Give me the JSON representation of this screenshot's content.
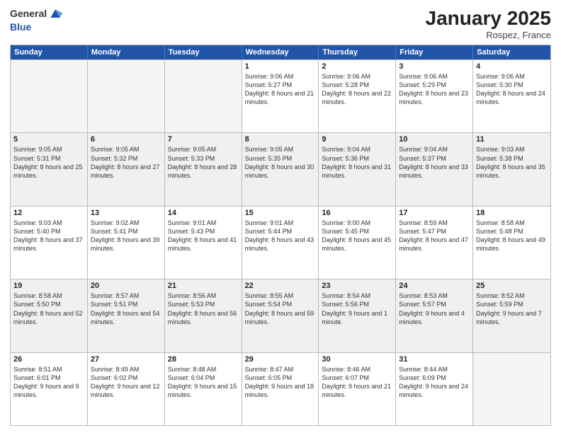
{
  "logo": {
    "general": "General",
    "blue": "Blue"
  },
  "title": "January 2025",
  "location": "Rospez, France",
  "days_of_week": [
    "Sunday",
    "Monday",
    "Tuesday",
    "Wednesday",
    "Thursday",
    "Friday",
    "Saturday"
  ],
  "weeks": [
    [
      {
        "day": "",
        "info": ""
      },
      {
        "day": "",
        "info": ""
      },
      {
        "day": "",
        "info": ""
      },
      {
        "day": "1",
        "info": "Sunrise: 9:06 AM\nSunset: 5:27 PM\nDaylight: 8 hours and 21 minutes."
      },
      {
        "day": "2",
        "info": "Sunrise: 9:06 AM\nSunset: 5:28 PM\nDaylight: 8 hours and 22 minutes."
      },
      {
        "day": "3",
        "info": "Sunrise: 9:06 AM\nSunset: 5:29 PM\nDaylight: 8 hours and 23 minutes."
      },
      {
        "day": "4",
        "info": "Sunrise: 9:06 AM\nSunset: 5:30 PM\nDaylight: 8 hours and 24 minutes."
      }
    ],
    [
      {
        "day": "5",
        "info": "Sunrise: 9:05 AM\nSunset: 5:31 PM\nDaylight: 8 hours and 25 minutes."
      },
      {
        "day": "6",
        "info": "Sunrise: 9:05 AM\nSunset: 5:32 PM\nDaylight: 8 hours and 27 minutes."
      },
      {
        "day": "7",
        "info": "Sunrise: 9:05 AM\nSunset: 5:33 PM\nDaylight: 8 hours and 28 minutes."
      },
      {
        "day": "8",
        "info": "Sunrise: 9:05 AM\nSunset: 5:35 PM\nDaylight: 8 hours and 30 minutes."
      },
      {
        "day": "9",
        "info": "Sunrise: 9:04 AM\nSunset: 5:36 PM\nDaylight: 8 hours and 31 minutes."
      },
      {
        "day": "10",
        "info": "Sunrise: 9:04 AM\nSunset: 5:37 PM\nDaylight: 8 hours and 33 minutes."
      },
      {
        "day": "11",
        "info": "Sunrise: 9:03 AM\nSunset: 5:38 PM\nDaylight: 8 hours and 35 minutes."
      }
    ],
    [
      {
        "day": "12",
        "info": "Sunrise: 9:03 AM\nSunset: 5:40 PM\nDaylight: 8 hours and 37 minutes."
      },
      {
        "day": "13",
        "info": "Sunrise: 9:02 AM\nSunset: 5:41 PM\nDaylight: 8 hours and 39 minutes."
      },
      {
        "day": "14",
        "info": "Sunrise: 9:01 AM\nSunset: 5:43 PM\nDaylight: 8 hours and 41 minutes."
      },
      {
        "day": "15",
        "info": "Sunrise: 9:01 AM\nSunset: 5:44 PM\nDaylight: 8 hours and 43 minutes."
      },
      {
        "day": "16",
        "info": "Sunrise: 9:00 AM\nSunset: 5:45 PM\nDaylight: 8 hours and 45 minutes."
      },
      {
        "day": "17",
        "info": "Sunrise: 8:59 AM\nSunset: 5:47 PM\nDaylight: 8 hours and 47 minutes."
      },
      {
        "day": "18",
        "info": "Sunrise: 8:58 AM\nSunset: 5:48 PM\nDaylight: 8 hours and 49 minutes."
      }
    ],
    [
      {
        "day": "19",
        "info": "Sunrise: 8:58 AM\nSunset: 5:50 PM\nDaylight: 8 hours and 52 minutes."
      },
      {
        "day": "20",
        "info": "Sunrise: 8:57 AM\nSunset: 5:51 PM\nDaylight: 8 hours and 54 minutes."
      },
      {
        "day": "21",
        "info": "Sunrise: 8:56 AM\nSunset: 5:53 PM\nDaylight: 8 hours and 56 minutes."
      },
      {
        "day": "22",
        "info": "Sunrise: 8:55 AM\nSunset: 5:54 PM\nDaylight: 8 hours and 59 minutes."
      },
      {
        "day": "23",
        "info": "Sunrise: 8:54 AM\nSunset: 5:56 PM\nDaylight: 9 hours and 1 minute."
      },
      {
        "day": "24",
        "info": "Sunrise: 8:53 AM\nSunset: 5:57 PM\nDaylight: 9 hours and 4 minutes."
      },
      {
        "day": "25",
        "info": "Sunrise: 8:52 AM\nSunset: 5:59 PM\nDaylight: 9 hours and 7 minutes."
      }
    ],
    [
      {
        "day": "26",
        "info": "Sunrise: 8:51 AM\nSunset: 6:01 PM\nDaylight: 9 hours and 9 minutes."
      },
      {
        "day": "27",
        "info": "Sunrise: 8:49 AM\nSunset: 6:02 PM\nDaylight: 9 hours and 12 minutes."
      },
      {
        "day": "28",
        "info": "Sunrise: 8:48 AM\nSunset: 6:04 PM\nDaylight: 9 hours and 15 minutes."
      },
      {
        "day": "29",
        "info": "Sunrise: 8:47 AM\nSunset: 6:05 PM\nDaylight: 9 hours and 18 minutes."
      },
      {
        "day": "30",
        "info": "Sunrise: 8:46 AM\nSunset: 6:07 PM\nDaylight: 9 hours and 21 minutes."
      },
      {
        "day": "31",
        "info": "Sunrise: 8:44 AM\nSunset: 6:09 PM\nDaylight: 9 hours and 24 minutes."
      },
      {
        "day": "",
        "info": ""
      }
    ]
  ]
}
